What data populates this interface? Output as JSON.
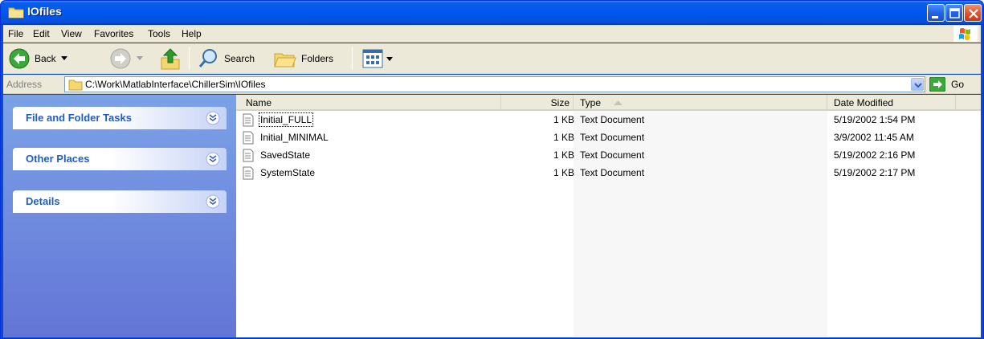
{
  "window": {
    "title": "IOfiles"
  },
  "menu": {
    "items": [
      "File",
      "Edit",
      "View",
      "Favorites",
      "Tools",
      "Help"
    ]
  },
  "toolbar": {
    "back_label": "Back",
    "search_label": "Search",
    "folders_label": "Folders"
  },
  "address": {
    "label": "Address",
    "value": "C:\\Work\\MatlabInterface\\ChillerSim\\IOfiles",
    "go_label": "Go"
  },
  "taskpane": {
    "sections": [
      {
        "title": "File and Folder Tasks"
      },
      {
        "title": "Other Places"
      },
      {
        "title": "Details"
      }
    ]
  },
  "listview": {
    "columns": [
      "Name",
      "Size",
      "Type",
      "Date Modified"
    ],
    "sorted_by": "Type",
    "rows": [
      {
        "name": "Initial_FULL",
        "size": "1 KB",
        "type": "Text Document",
        "modified": "5/19/2002 1:54 PM"
      },
      {
        "name": "Initial_MINIMAL",
        "size": "1 KB",
        "type": "Text Document",
        "modified": "3/9/2002 11:45 AM"
      },
      {
        "name": "SavedState",
        "size": "1 KB",
        "type": "Text Document",
        "modified": "5/19/2002 2:16 PM"
      },
      {
        "name": "SystemState",
        "size": "1 KB",
        "type": "Text Document",
        "modified": "5/19/2002 2:17 PM"
      }
    ]
  },
  "colors": {
    "titlebar": "#0054e3",
    "chrome": "#ece9d8",
    "taskpane_link": "#215dc6"
  }
}
